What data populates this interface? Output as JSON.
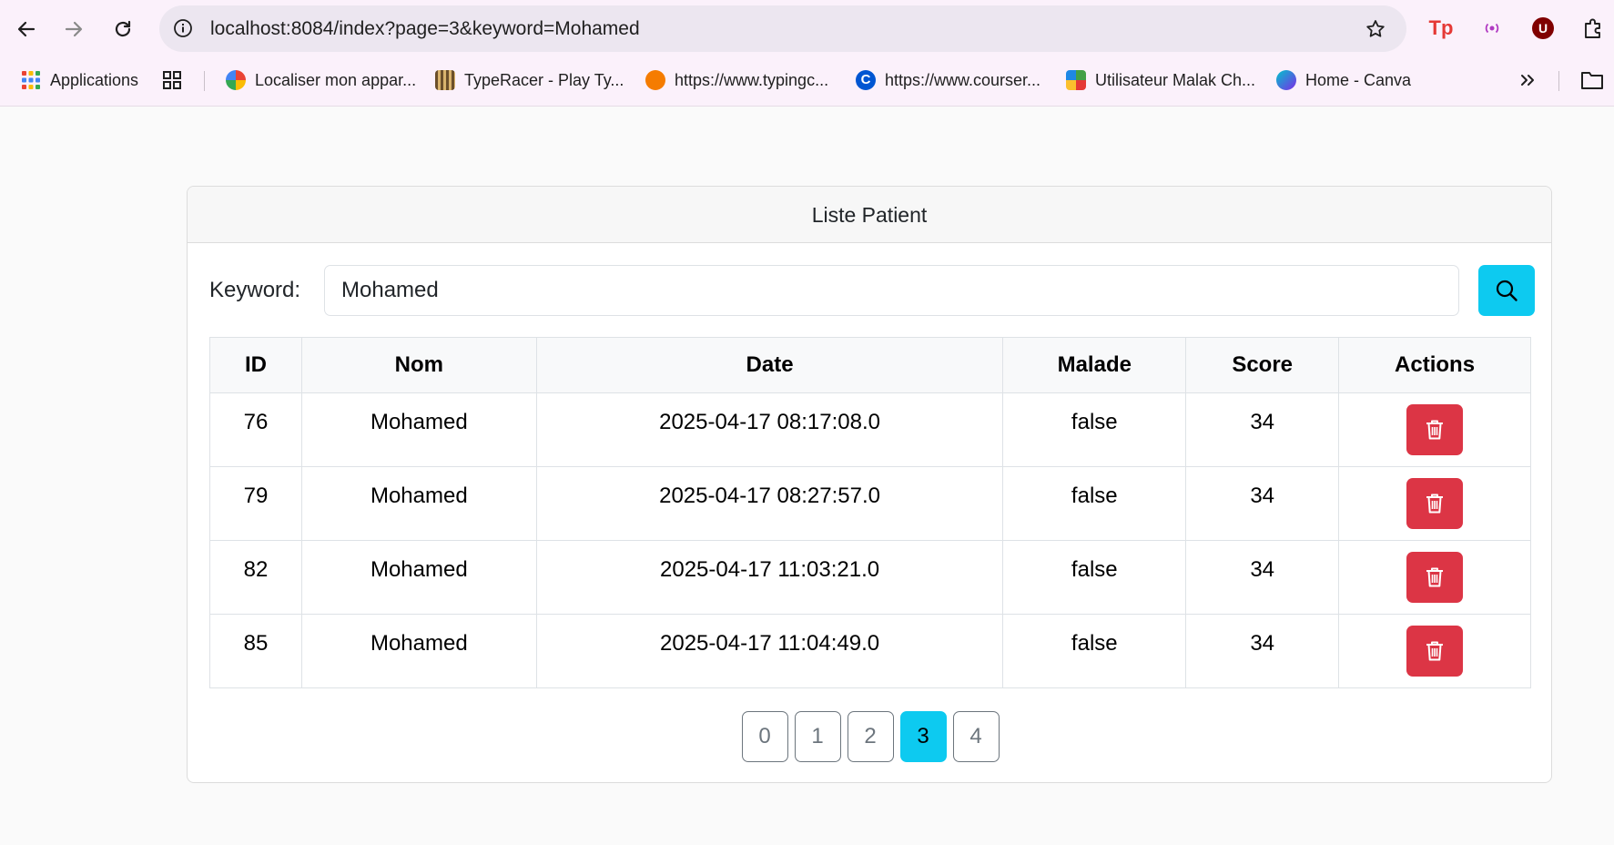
{
  "browser": {
    "url": "localhost:8084/index?page=3&keyword=Mohamed",
    "bookmarks": [
      {
        "label": "Applications",
        "icon": "apps-grid-icon",
        "color": "#4285f4"
      },
      {
        "label": "Localiser mon appar...",
        "icon": "google-find-icon",
        "color": "#34a853"
      },
      {
        "label": "TypeRacer - Play Ty...",
        "icon": "typeracer-icon",
        "color": "#6b4f2a"
      },
      {
        "label": "https://www.typingc...",
        "icon": "typingclub-icon",
        "color": "#f57c00"
      },
      {
        "label": "https://www.courser...",
        "icon": "coursera-icon",
        "color": "#0056d2"
      },
      {
        "label": "Utilisateur Malak Ch...",
        "icon": "tictac-icon",
        "color": "#43a047"
      },
      {
        "label": "Home - Canva",
        "icon": "canva-icon",
        "color": "#7d2ae8"
      }
    ]
  },
  "card": {
    "title": "Liste Patient",
    "keyword_label": "Keyword:",
    "keyword_value": "Mohamed"
  },
  "table": {
    "headers": [
      "ID",
      "Nom",
      "Date",
      "Malade",
      "Score",
      "Actions"
    ],
    "rows": [
      {
        "id": "76",
        "nom": "Mohamed",
        "date": "2025-04-17 08:17:08.0",
        "malade": "false",
        "score": "34"
      },
      {
        "id": "79",
        "nom": "Mohamed",
        "date": "2025-04-17 08:27:57.0",
        "malade": "false",
        "score": "34"
      },
      {
        "id": "82",
        "nom": "Mohamed",
        "date": "2025-04-17 11:03:21.0",
        "malade": "false",
        "score": "34"
      },
      {
        "id": "85",
        "nom": "Mohamed",
        "date": "2025-04-17 11:04:49.0",
        "malade": "false",
        "score": "34"
      }
    ]
  },
  "pagination": {
    "pages": [
      "0",
      "1",
      "2",
      "3",
      "4"
    ],
    "current": "3"
  },
  "colors": {
    "accent": "#0dcaf0",
    "danger": "#dc3545"
  }
}
